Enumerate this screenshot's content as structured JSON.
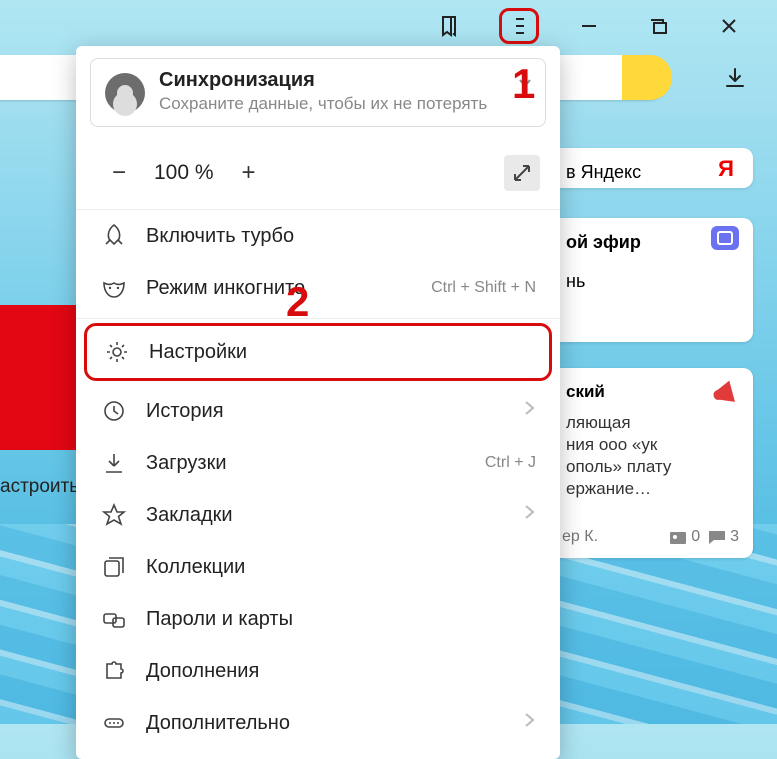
{
  "titlebar": {
    "bookmark_icon": "bookmark-icon",
    "menu_icon": "menu-icon",
    "minimize_icon": "minimize-icon",
    "restore_icon": "restore-icon",
    "close_icon": "close-icon",
    "download_icon": "download-icon"
  },
  "callouts": {
    "one": "1",
    "two": "2"
  },
  "menu": {
    "sync": {
      "title": "Синхронизация",
      "subtitle": "Сохраните данные, чтобы их не потерять"
    },
    "zoom": {
      "minus": "−",
      "value": "100 %",
      "plus": "+",
      "fullscreen_icon": "fullscreen-icon"
    },
    "items": [
      {
        "icon": "rocket-icon",
        "label": "Включить турбо",
        "shortcut": "",
        "arrow": false
      },
      {
        "icon": "mask-icon",
        "label": "Режим инкогнито",
        "shortcut": "Ctrl + Shift + N",
        "arrow": false
      },
      {
        "icon": "gear-icon",
        "label": "Настройки",
        "shortcut": "",
        "arrow": false,
        "highlight": true
      },
      {
        "icon": "clock-icon",
        "label": "История",
        "shortcut": "",
        "arrow": true
      },
      {
        "icon": "download-icon",
        "label": "Загрузки",
        "shortcut": "Ctrl + J",
        "arrow": false
      },
      {
        "icon": "star-icon",
        "label": "Закладки",
        "shortcut": "",
        "arrow": true
      },
      {
        "icon": "collections-icon",
        "label": "Коллекции",
        "shortcut": "",
        "arrow": false
      },
      {
        "icon": "keys-icon",
        "label": "Пароли и карты",
        "shortcut": "",
        "arrow": false
      },
      {
        "icon": "puzzle-icon",
        "label": "Дополнения",
        "shortcut": "",
        "arrow": false
      },
      {
        "icon": "more-icon",
        "label": "Дополнительно",
        "shortcut": "",
        "arrow": true
      }
    ]
  },
  "cards": {
    "c1": "в Яндекс",
    "c2a": "ой эфир",
    "c2b": "нь",
    "c3title": "ский",
    "c3l1": "ляющая",
    "c3l2": "ния ооо «ук",
    "c3l3": "ополь» плату",
    "c3l4": "ержание…",
    "c3author": "ер К.",
    "c3photos": "0",
    "c3comments": "3"
  },
  "astro": "астроить"
}
